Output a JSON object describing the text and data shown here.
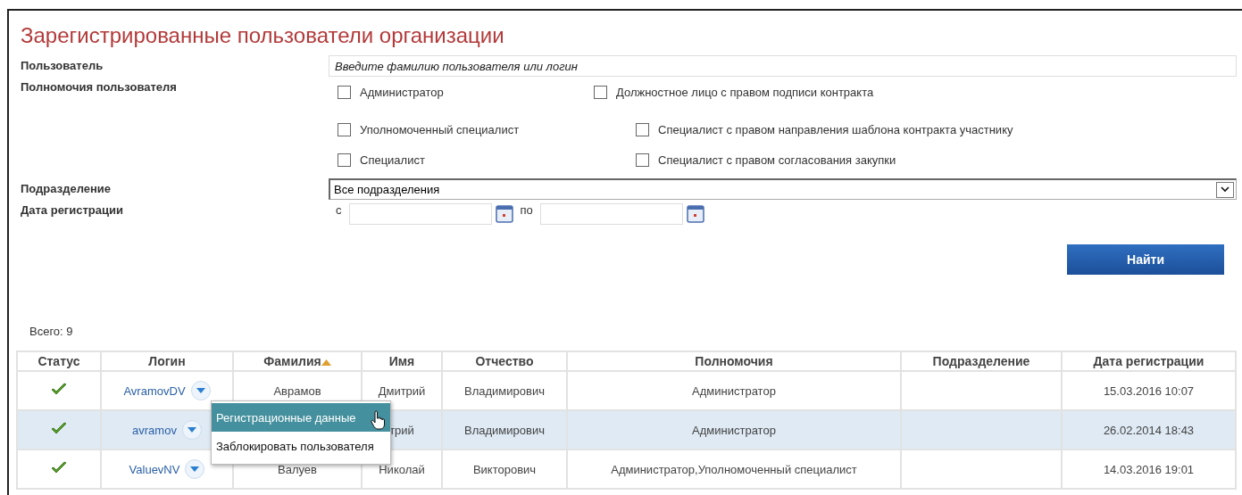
{
  "title": "Зарегистрированные пользователи организации",
  "user_field": {
    "label": "Пользователь",
    "placeholder": "Введите фамилию пользователя или логин"
  },
  "permissions": {
    "label": "Полномочия пользователя",
    "options": [
      {
        "label": "Администратор",
        "checked": false
      },
      {
        "label": "Должностное лицо с правом подписи контракта",
        "checked": false
      },
      {
        "label": "Уполномоченный специалист",
        "checked": false
      },
      {
        "label": "Специалист с правом направления шаблона контракта участнику",
        "checked": false
      },
      {
        "label": "Специалист",
        "checked": false
      },
      {
        "label": "Специалист с правом согласования закупки",
        "checked": false
      }
    ]
  },
  "department": {
    "label": "Подразделение",
    "value": "Все подразделения"
  },
  "date": {
    "label": "Дата регистрации",
    "from_label": "с",
    "to_label": "по"
  },
  "search_button": "Найти",
  "total": "Всего: 9",
  "table": {
    "columns": [
      {
        "label": "Статус",
        "sorted": false
      },
      {
        "label": "Логин",
        "sorted": false
      },
      {
        "label": "Фамилия",
        "sorted": true
      },
      {
        "label": "Имя",
        "sorted": false
      },
      {
        "label": "Отчество",
        "sorted": false
      },
      {
        "label": "Полномочия",
        "sorted": false
      },
      {
        "label": "Подразделение",
        "sorted": false
      },
      {
        "label": "Дата регистрации",
        "sorted": false
      }
    ],
    "rows": [
      {
        "active": true,
        "selected": false,
        "login": "AvramovDV",
        "surname": "Аврамов",
        "name": "Дмитрий",
        "patronymic": "Владимирович",
        "permissions": "Администратор",
        "date": "15.03.2016 10:07"
      },
      {
        "active": true,
        "selected": true,
        "login": "avramov",
        "name": "трий",
        "patronymic": "Владимирович",
        "permissions": "Администратор",
        "date": "26.02.2014 18:43"
      },
      {
        "active": true,
        "selected": false,
        "login": "ValuevNV",
        "surname": "Валуев",
        "name": "Николай",
        "patronymic": "Викторович",
        "permissions": "Администратор,Уполномоченный специалист",
        "date": "14.03.2016 19:01"
      }
    ]
  },
  "context_menu": [
    {
      "label": "Регистрационные данные",
      "selected": true
    },
    {
      "label": "Заблокировать пользователя",
      "selected": false
    }
  ]
}
